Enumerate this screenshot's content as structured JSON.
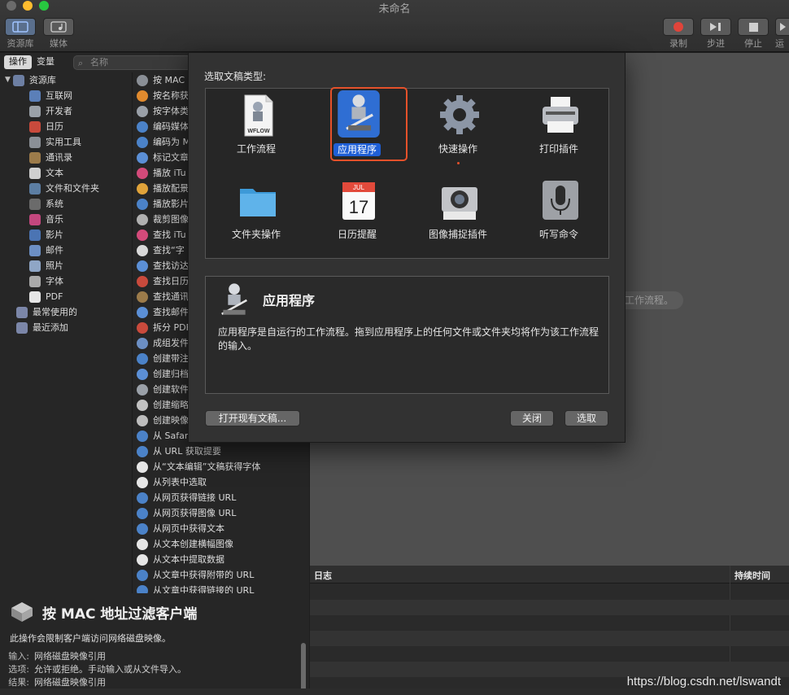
{
  "window": {
    "title": "未命名"
  },
  "toolbar": {
    "left": [
      {
        "label": "资源库",
        "icon": "library-icon"
      },
      {
        "label": "媒体",
        "icon": "media-icon"
      }
    ],
    "right": [
      {
        "label": "录制",
        "icon": "record-icon"
      },
      {
        "label": "步进",
        "icon": "step-icon"
      },
      {
        "label": "停止",
        "icon": "stop-icon"
      },
      {
        "label": "运",
        "icon": "run-icon"
      }
    ]
  },
  "library": {
    "tabs": [
      "操作",
      "变量"
    ],
    "search_placeholder": "名称",
    "root": "资源库",
    "categories": [
      "互联网",
      "开发者",
      "日历",
      "实用工具",
      "通讯录",
      "文本",
      "文件和文件夹",
      "系统",
      "音乐",
      "影片",
      "邮件",
      "照片",
      "字体",
      "PDF"
    ],
    "smart": [
      "最常使用的",
      "最近添加"
    ],
    "actions": [
      "按 MAC",
      "按名称获",
      "按字体类",
      "编码媒体",
      "编码为 M",
      "标记文章",
      "播放 iTu",
      "播放配景",
      "播放影片",
      "裁剪图像",
      "查找 iTu",
      "查找“字",
      "查找访达",
      "查找日历",
      "查找通讯",
      "查找邮件",
      "拆分 PDF",
      "成组发件",
      "创建带注",
      "创建归档",
      "创建软件",
      "创建缩略",
      "创建映像",
      "从 Safar",
      "从 URL 获取提要",
      "从“文本编辑”文稿获得字体",
      "从列表中选取",
      "从网页获得链接 URL",
      "从网页获得图像 URL",
      "从网页中获得文本",
      "从文本创建横幅图像",
      "从文本中提取数据",
      "从文章中获得附带的 URL",
      "从文章中获得链接的 URL"
    ]
  },
  "action_info": {
    "title": "按 MAC 地址过滤客户端",
    "description": "此操作会限制客户端访问网络磁盘映像。",
    "fields": [
      {
        "key": "输入:",
        "value": "网络磁盘映像引用"
      },
      {
        "key": "选项:",
        "value": "允许或拒绝。手动输入或从文件导入。"
      },
      {
        "key": "结果:",
        "value": "网络磁盘映像引用"
      }
    ]
  },
  "workflow": {
    "hint": "工作流程。"
  },
  "log": {
    "col_log": "日志",
    "col_duration": "持续时间"
  },
  "sheet": {
    "prompt": "选取文稿类型:",
    "types": [
      {
        "label": "工作流程",
        "icon": "workflow-icon",
        "selected": false
      },
      {
        "label": "应用程序",
        "icon": "application-robot-icon",
        "selected": true
      },
      {
        "label": "快速操作",
        "icon": "gear-icon",
        "selected": false
      },
      {
        "label": "打印插件",
        "icon": "printer-icon",
        "selected": false
      },
      {
        "label": "文件夹操作",
        "icon": "folder-icon",
        "selected": false
      },
      {
        "label": "日历提醒",
        "icon": "calendar-icon",
        "selected": false
      },
      {
        "label": "图像捕捉插件",
        "icon": "camera-icon",
        "selected": false
      },
      {
        "label": "听写命令",
        "icon": "microphone-icon",
        "selected": false
      }
    ],
    "wflow_badge": "WFLOW",
    "cal_month": "JUL",
    "cal_day": "17",
    "detail_title": "应用程序",
    "detail_text": "应用程序是自运行的工作流程。拖到应用程序上的任何文件或文件夹均将作为该工作流程的输入。",
    "open_existing": "打开现有文稿...",
    "close": "关闭",
    "choose": "选取"
  },
  "watermark": "https://blog.csdn.net/lswandt",
  "colors": {
    "selection_outline": "#e5512a",
    "selected_label": "#1f5fd6"
  }
}
